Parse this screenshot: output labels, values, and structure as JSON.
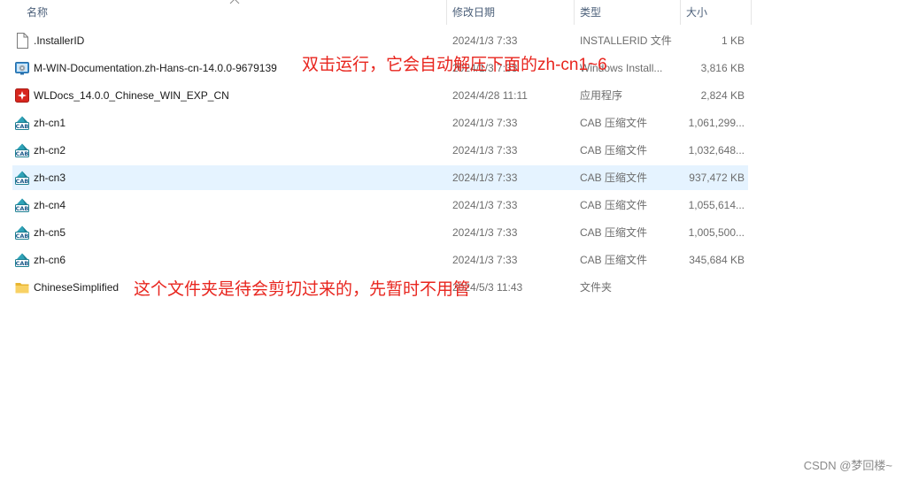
{
  "columns": {
    "name": "名称",
    "date": "修改日期",
    "type": "类型",
    "size": "大小"
  },
  "files": [
    {
      "name": ".InstallerID",
      "date": "2024/1/3 7:33",
      "type": "INSTALLERID 文件",
      "size": "1 KB",
      "icon": "file-icon"
    },
    {
      "name": "M-WIN-Documentation.zh-Hans-cn-14.0.0-9679139",
      "date": "2024/1/3 7:33",
      "type": "Windows Install...",
      "size": "3,816 KB",
      "icon": "installer-icon"
    },
    {
      "name": "WLDocs_14.0.0_Chinese_WIN_EXP_CN",
      "date": "2024/4/28 11:11",
      "type": "应用程序",
      "size": "2,824 KB",
      "icon": "application-icon"
    },
    {
      "name": "zh-cn1",
      "date": "2024/1/3 7:33",
      "type": "CAB 压缩文件",
      "size": "1,061,299...",
      "icon": "cab-icon"
    },
    {
      "name": "zh-cn2",
      "date": "2024/1/3 7:33",
      "type": "CAB 压缩文件",
      "size": "1,032,648...",
      "icon": "cab-icon"
    },
    {
      "name": "zh-cn3",
      "date": "2024/1/3 7:33",
      "type": "CAB 压缩文件",
      "size": "937,472 KB",
      "icon": "cab-icon",
      "selected": true
    },
    {
      "name": "zh-cn4",
      "date": "2024/1/3 7:33",
      "type": "CAB 压缩文件",
      "size": "1,055,614...",
      "icon": "cab-icon"
    },
    {
      "name": "zh-cn5",
      "date": "2024/1/3 7:33",
      "type": "CAB 压缩文件",
      "size": "1,005,500...",
      "icon": "cab-icon"
    },
    {
      "name": "zh-cn6",
      "date": "2024/1/3 7:33",
      "type": "CAB 压缩文件",
      "size": "345,684 KB",
      "icon": "cab-icon"
    },
    {
      "name": "ChineseSimplified",
      "date": "2024/5/3 11:43",
      "type": "文件夹",
      "size": "",
      "icon": "folder-icon"
    }
  ],
  "annotations": [
    "双击运行，它会自动解压下面的zh-cn1~6",
    "这个文件夹是待会剪切过来的，先暂时不用管"
  ],
  "watermark": "CSDN @梦回楼~",
  "colors": {
    "selection": "#e5f3ff",
    "annotation": "#e8251e",
    "header_text": "#4c607a"
  }
}
